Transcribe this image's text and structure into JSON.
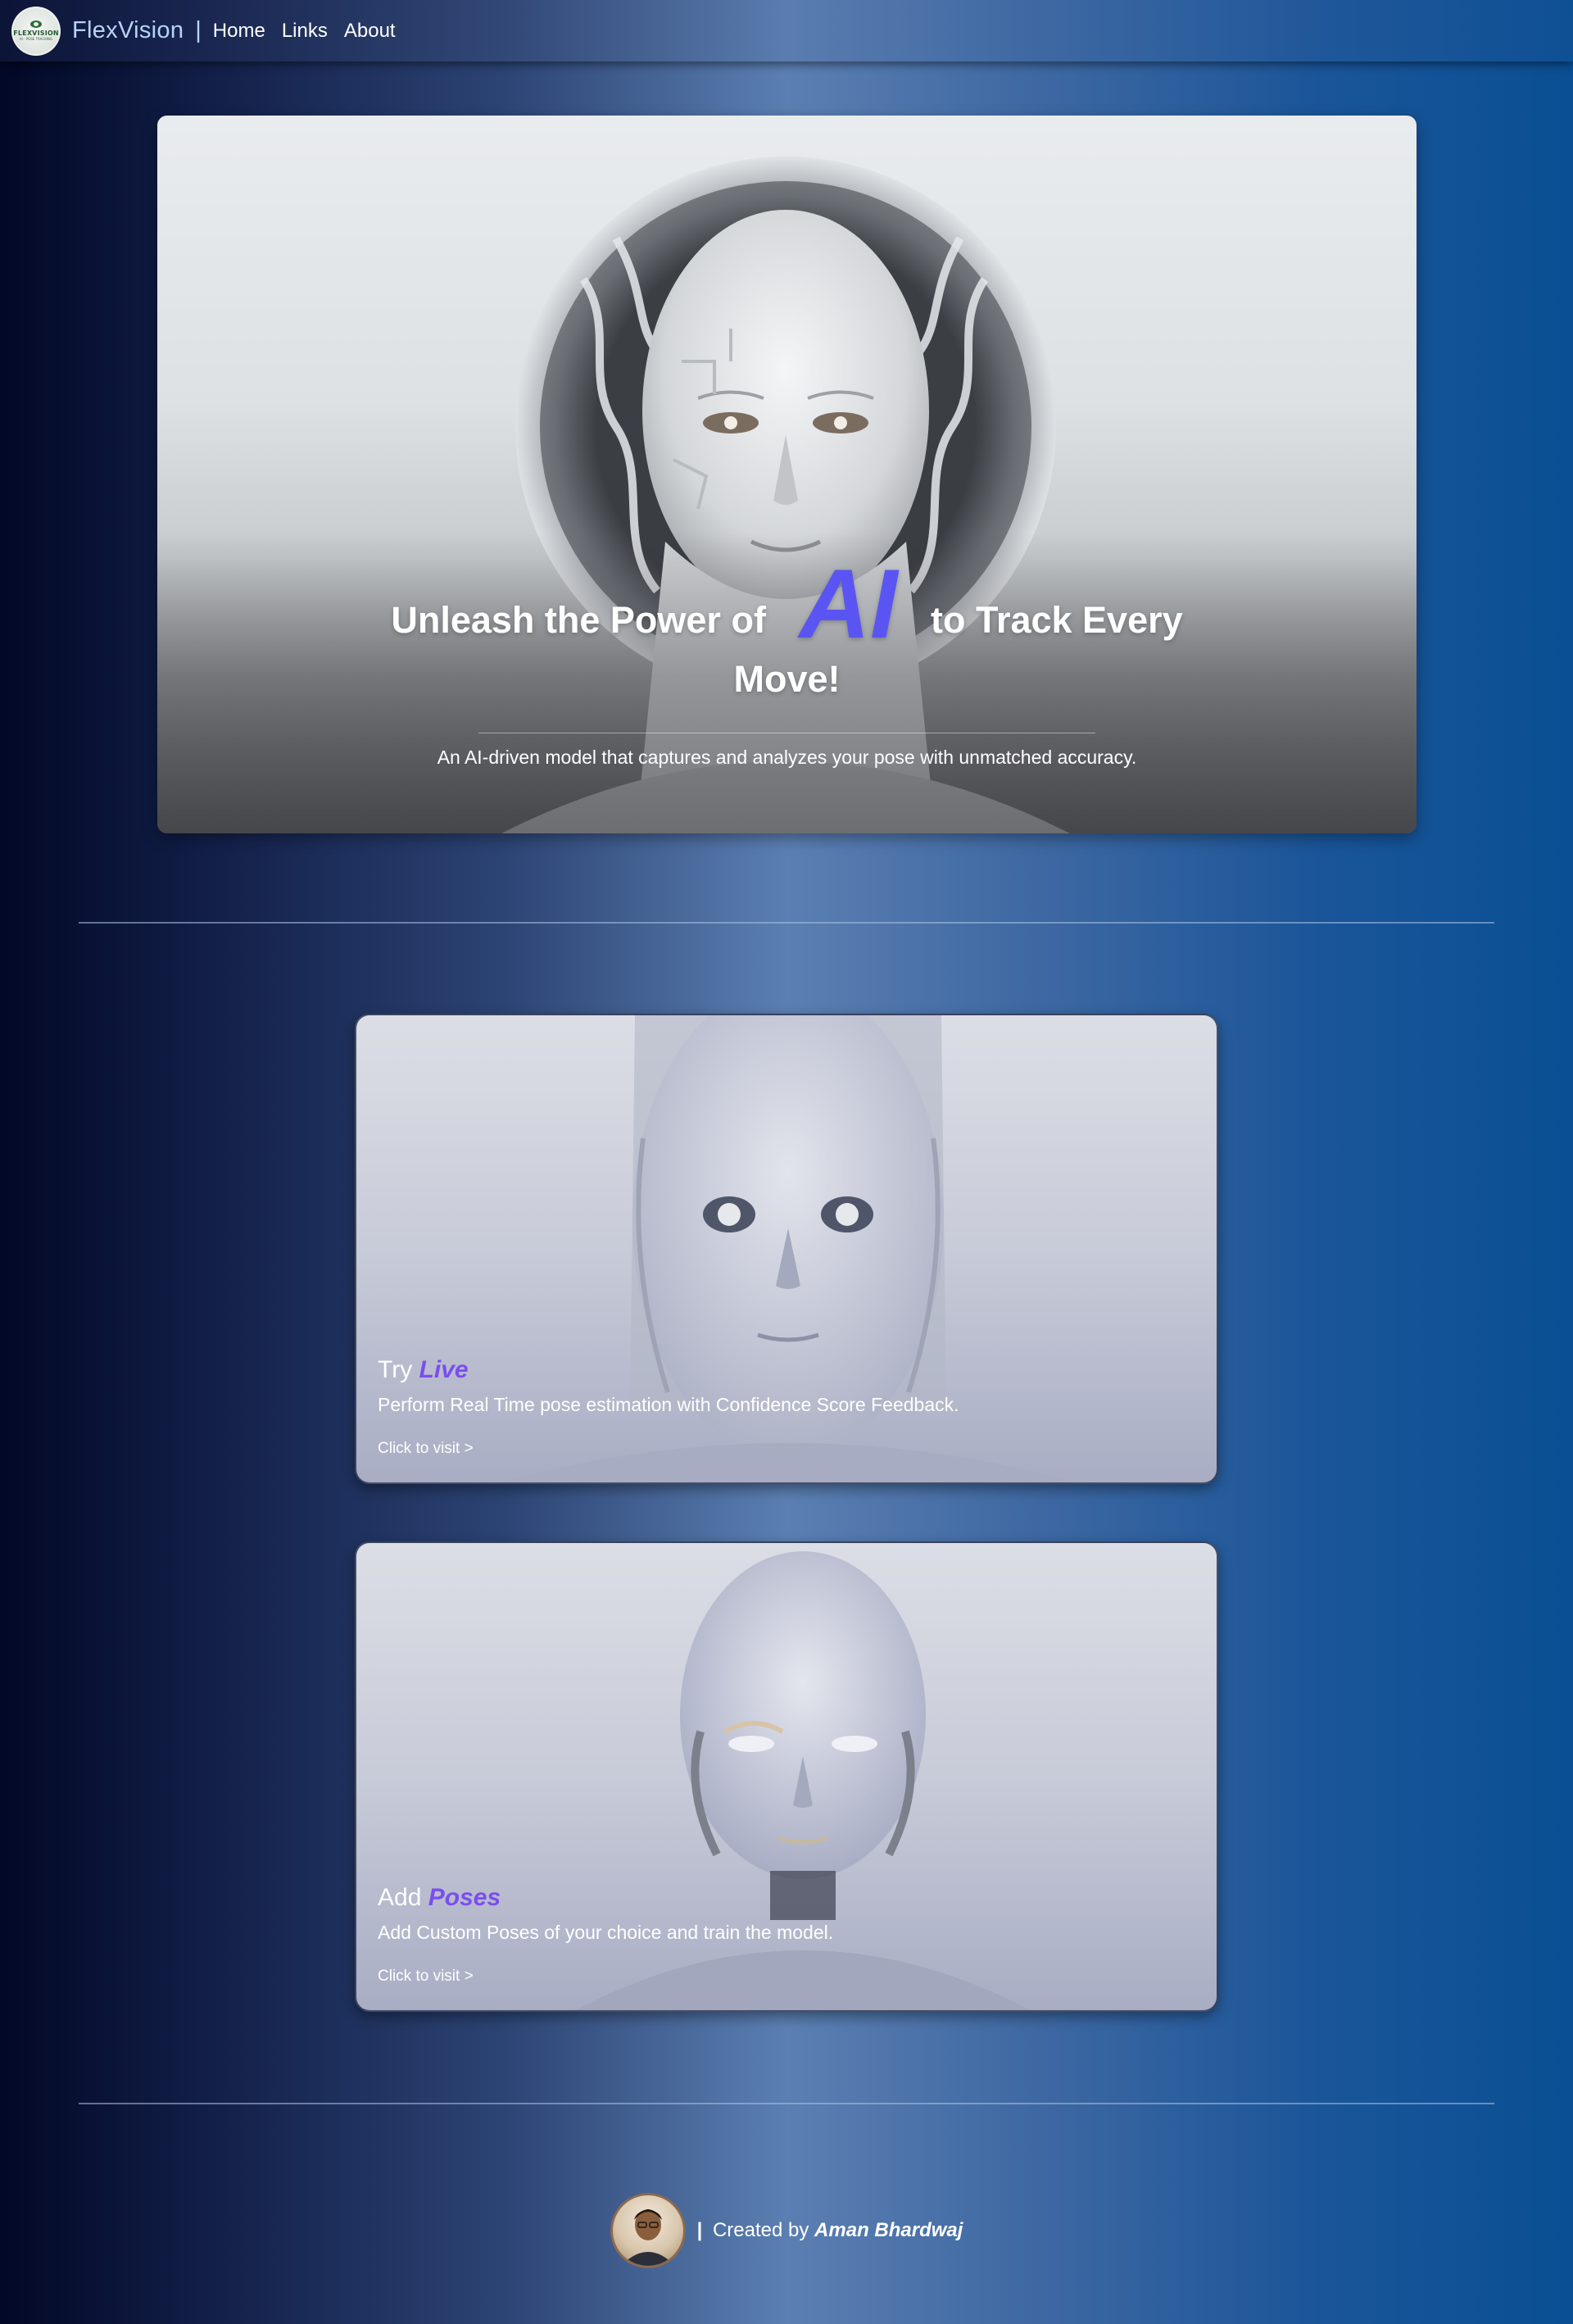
{
  "navbar": {
    "logo_text": "FLEXVISION",
    "logo_sub": "AI · POSE TRACKING",
    "brand": "FlexVision",
    "separator": "|",
    "links": [
      "Home",
      "Links",
      "About"
    ]
  },
  "hero": {
    "title_before": "Unleash the Power of",
    "title_highlight": "AI",
    "title_after": "to Track Every",
    "title_line2": "Move!",
    "subtitle": "An AI-driven model that captures and analyzes your pose with unmatched accuracy."
  },
  "cards": [
    {
      "title_prefix": "Try",
      "title_highlight": "Live",
      "description": "Perform Real Time pose estimation with Confidence Score Feedback.",
      "link": "Click to visit >"
    },
    {
      "title_prefix": "Add",
      "title_highlight": "Poses",
      "description": "Add Custom Poses of your choice and train the model.",
      "link": "Click to visit >"
    }
  ],
  "footer": {
    "separator": "|",
    "created_by": "Created by",
    "author": "Aman Bhardwaj"
  },
  "colors": {
    "accent_purple": "#7a4ef0",
    "accent_blue": "#3d8ff0",
    "brand_text": "#b9d3f8"
  }
}
